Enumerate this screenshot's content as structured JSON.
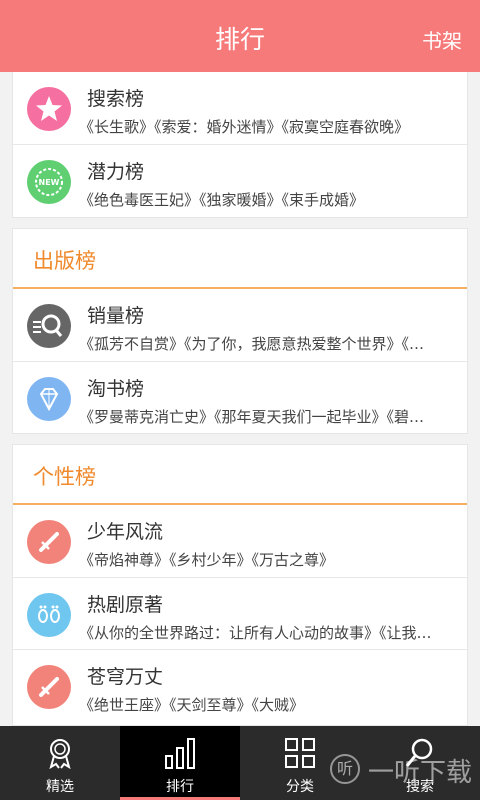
{
  "header": {
    "title": "排行",
    "shelf": "书架"
  },
  "sections": {
    "top": {
      "rows": [
        {
          "name": "搜索榜",
          "books": "《长生歌》《索爱：婚外迷情》《寂寞空庭春欲晚》",
          "icon": "star-icon"
        },
        {
          "name": "潜力榜",
          "books": "《绝色毒医王妃》《独家暖婚》《束手成婚》",
          "icon": "new-badge-icon"
        }
      ]
    },
    "publish": {
      "title": "出版榜",
      "rows": [
        {
          "name": "销量榜",
          "books": "《孤芳不自赏》《为了你，我愿意热爱整个世界》《…",
          "icon": "magnifier-icon"
        },
        {
          "name": "淘书榜",
          "books": "《罗曼蒂克消亡史》《那年夏天我们一起毕业》《碧…",
          "icon": "diamond-icon"
        }
      ]
    },
    "personal": {
      "title": "个性榜",
      "rows": [
        {
          "name": "少年风流",
          "books": "《帝焰神尊》《乡村少年》《万古之尊》",
          "icon": "sword-icon"
        },
        {
          "name": "热剧原著",
          "books": "《从你的全世界路过：让所有人心动的故事》《让我…",
          "icon": "footprint-icon"
        },
        {
          "name": "苍穹万丈",
          "books": "《绝世王座》《天剑至尊》《大贼》",
          "icon": "sword-icon"
        }
      ]
    }
  },
  "tabbar": {
    "tabs": [
      {
        "label": "精选",
        "icon": "medal-icon",
        "active": false
      },
      {
        "label": "排行",
        "icon": "bar-chart-icon",
        "active": true
      },
      {
        "label": "分类",
        "icon": "grid-icon",
        "active": false
      },
      {
        "label": "搜索",
        "icon": "search-icon",
        "active": false
      }
    ]
  },
  "watermark": {
    "text": "一听下载",
    "badge": "听"
  },
  "colors": {
    "header": "#f77a7a",
    "section_title": "#f08a2d",
    "tabbar": "#2b2b2b"
  }
}
